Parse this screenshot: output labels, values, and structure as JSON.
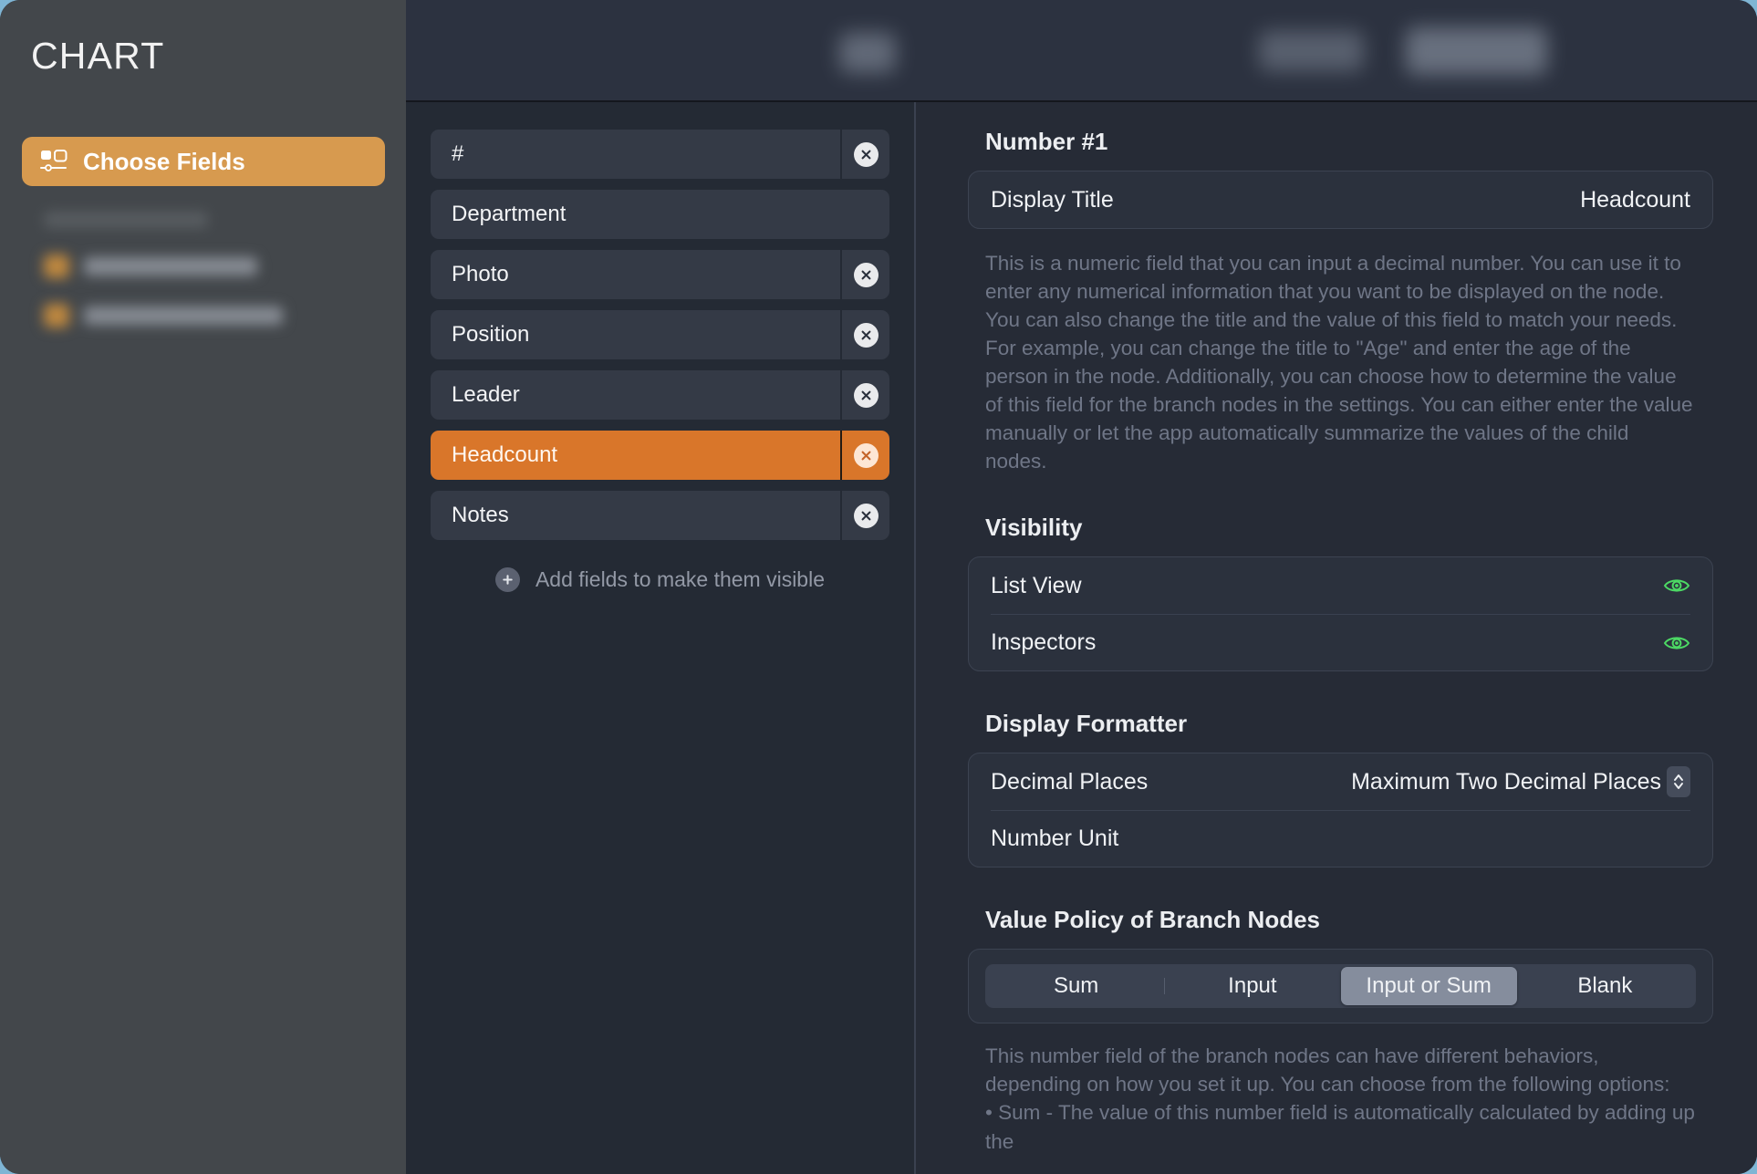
{
  "sidebar": {
    "title": "CHART",
    "choose_fields": {
      "label": "Choose Fields",
      "icon": "fields-picker-icon",
      "accent": "#d79a4f"
    },
    "blurred_items": [
      {
        "label": ""
      },
      {
        "label": ""
      },
      {
        "label": ""
      }
    ]
  },
  "toolbar": {
    "blurred": true,
    "items": [
      {
        "label": ""
      },
      {
        "label": ""
      },
      {
        "label": ""
      },
      {
        "label": ""
      }
    ]
  },
  "fields_panel": {
    "rows": [
      {
        "name": "#",
        "deletable": true,
        "selected": false
      },
      {
        "name": "Department",
        "deletable": false,
        "selected": false
      },
      {
        "name": "Photo",
        "deletable": true,
        "selected": false
      },
      {
        "name": "Position",
        "deletable": true,
        "selected": false
      },
      {
        "name": "Leader",
        "deletable": true,
        "selected": false
      },
      {
        "name": "Headcount",
        "deletable": true,
        "selected": true
      },
      {
        "name": "Notes",
        "deletable": true,
        "selected": false
      }
    ],
    "add_fields_label": "Add fields to make them visible",
    "add_icon": "plus-circle-icon",
    "delete_icon": "close-circle-icon",
    "selected_color": "#d9762a"
  },
  "inspector": {
    "field_header": "Number #1",
    "display_title": {
      "label": "Display Title",
      "value": "Headcount"
    },
    "field_description": "This is a numeric field that you can input a decimal number. You can use it to enter any numerical information that you want to be displayed on the node. You can also change the title and the value of this field to match your needs. For example, you can change the title to \"Age\" and enter the age of the person in the node. Additionally, you can choose how to determine the value of this field for the branch nodes in the settings. You can either enter the value manually or let the app automatically summarize the values of the child nodes.",
    "visibility": {
      "title": "Visibility",
      "rows": [
        {
          "label": "List View",
          "icon": "eye-icon",
          "state": "visible"
        },
        {
          "label": "Inspectors",
          "icon": "eye-icon",
          "state": "visible"
        }
      ],
      "eye_color": "#4cd964"
    },
    "display_formatter": {
      "title": "Display Formatter",
      "decimal_places": {
        "label": "Decimal Places",
        "value": "Maximum Two Decimal Places",
        "icon": "chevron-up-down-icon"
      },
      "number_unit": {
        "label": "Number Unit",
        "value": ""
      }
    },
    "value_policy": {
      "title": "Value Policy of Branch Nodes",
      "options": [
        "Sum",
        "Input",
        "Input or Sum",
        "Blank"
      ],
      "selected": "Input or Sum",
      "description_line1": "This number field of the branch nodes can have different behaviors, depending on how you set it up. You can choose from the following options:",
      "description_bullet": "• Sum - The value of this number field is automatically calculated by adding up the"
    }
  }
}
